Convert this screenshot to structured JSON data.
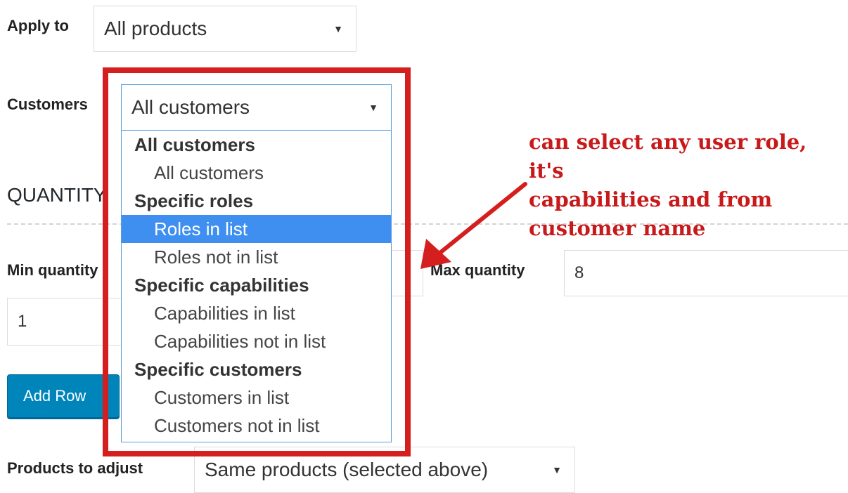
{
  "apply_to": {
    "label": "Apply to",
    "value": "All products"
  },
  "customers": {
    "label": "Customers",
    "value": "All customers"
  },
  "dropdown": {
    "groups": [
      {
        "label": "All customers",
        "options": [
          "All customers"
        ]
      },
      {
        "label": "Specific roles",
        "options": [
          "Roles in list",
          "Roles not in list"
        ]
      },
      {
        "label": "Specific capabilities",
        "options": [
          "Capabilities in list",
          "Capabilities not in list"
        ]
      },
      {
        "label": "Specific customers",
        "options": [
          "Customers in list",
          "Customers not in list"
        ]
      }
    ],
    "highlighted": "Roles in list"
  },
  "section_heading": "QUANTITY",
  "min_quantity": {
    "label": "Min quantity",
    "value": "1"
  },
  "max_quantity": {
    "label": "Max quantity",
    "value": "8"
  },
  "add_row_button": "Add Row",
  "products_to_adjust": {
    "label": "Products to adjust",
    "value": "Same products (selected above)"
  },
  "annotation": {
    "lines": [
      "can select any user role, it's",
      "capabilities and from",
      "customer name"
    ],
    "color": "#c8191b"
  },
  "highlight_box_color": "#d51e1e",
  "accent_color": "#3f8ff0"
}
